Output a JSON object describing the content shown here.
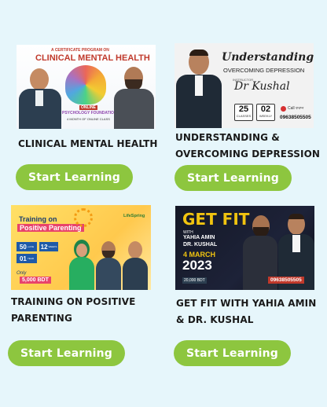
{
  "courses": [
    {
      "title_lines": [
        "CLINICAL MENTAL HEALTH"
      ],
      "button": "Start Learning",
      "thumb": {
        "top": "A CERTIFICATE PROGRAM ON",
        "headline": "CLINICAL MENTAL HEALTH",
        "tag": "ONLINE",
        "line1": "PSYCHOLOGY FOUNDATION COURSE",
        "line2": "4 MONTH OF ONLINE CLASS"
      }
    },
    {
      "title_lines": [
        "UNDERSTANDING &",
        "OVERCOMING DEPRESSION"
      ],
      "button": "Start Learning",
      "thumb": {
        "line1": "Understanding &",
        "line2": "OVERCOMING DEPRESSION",
        "instructor_label": "INSTRUCTOR",
        "signature": "Dr Kushal",
        "classes_num": "25",
        "classes_label": "CLASSES",
        "weeks_num": "02",
        "weeks_label": "WEEKLY",
        "call_label": "Call করুন",
        "phone": "09638505505"
      }
    },
    {
      "title_lines": [
        "TRAINING ON POSITIVE",
        "PARENTING"
      ],
      "button": "Start Learning",
      "thumb": {
        "line1": "Training on",
        "line2": "Positive Parenting",
        "brand": "LifeSpring",
        "stat1": "50",
        "stat1_unit": "+LIVE",
        "stat2": "12",
        "stat2_unit": "WEEKS",
        "stat3": "01",
        "stat3_unit": "YEAR",
        "only": "Only",
        "price": "5,000 BDT"
      }
    },
    {
      "title_lines": [
        "GET FIT WITH YAHIA AMIN",
        "& DR. KUSHAL"
      ],
      "button": "Start Learning",
      "thumb": {
        "headline": "GET FIT",
        "with": "WITH",
        "name1": "YAHIA AMIN",
        "name2": "DR. KUSHAL",
        "date": "4 MARCH",
        "year": "2023",
        "fee": "20,000 BDT",
        "phone": "09638505505"
      }
    }
  ],
  "colors": {
    "page_bg": "#e6f6fb",
    "button_bg": "#8dc63f",
    "button_text": "#ffffff",
    "title_text": "#1a1a1a"
  }
}
